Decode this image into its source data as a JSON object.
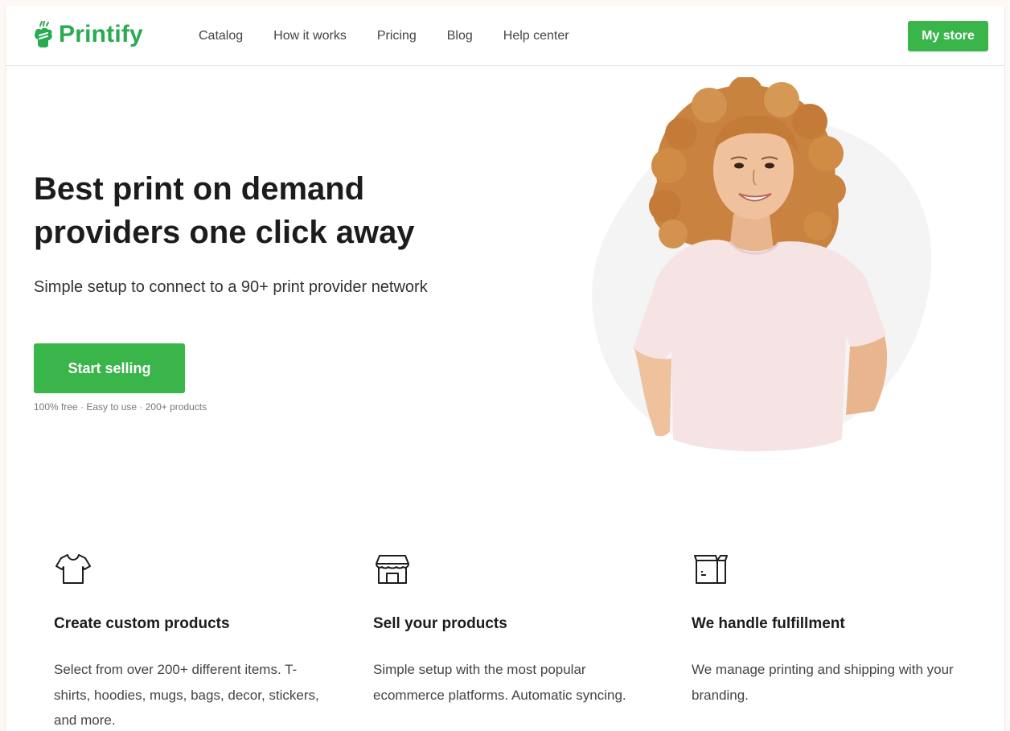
{
  "header": {
    "logo_text": "Printify",
    "nav": [
      "Catalog",
      "How it works",
      "Pricing",
      "Blog",
      "Help center"
    ],
    "my_store_label": "My store"
  },
  "hero": {
    "title_line1": "Best print on demand",
    "title_line2": "providers one click away",
    "subtitle": "Simple setup to connect to a 90+ print provider network",
    "cta_label": "Start selling",
    "meta": "100% free · Easy to use · 200+ products"
  },
  "features": [
    {
      "icon": "t-shirt-icon",
      "title": "Create custom products",
      "description": "Select from over 200+ different items. T-shirts, hoodies, mugs, bags, decor, stickers, and more."
    },
    {
      "icon": "storefront-icon",
      "title": "Sell your products",
      "description": "Simple setup with the most popular ecommerce platforms. Automatic syncing."
    },
    {
      "icon": "box-icon",
      "title": "We handle fulfillment",
      "description": "We manage printing and shipping with your branding."
    }
  ],
  "colors": {
    "brand_green": "#29ab51",
    "button_green": "#39b54a",
    "text_dark": "#1c1c1c",
    "text_body": "#444444"
  }
}
